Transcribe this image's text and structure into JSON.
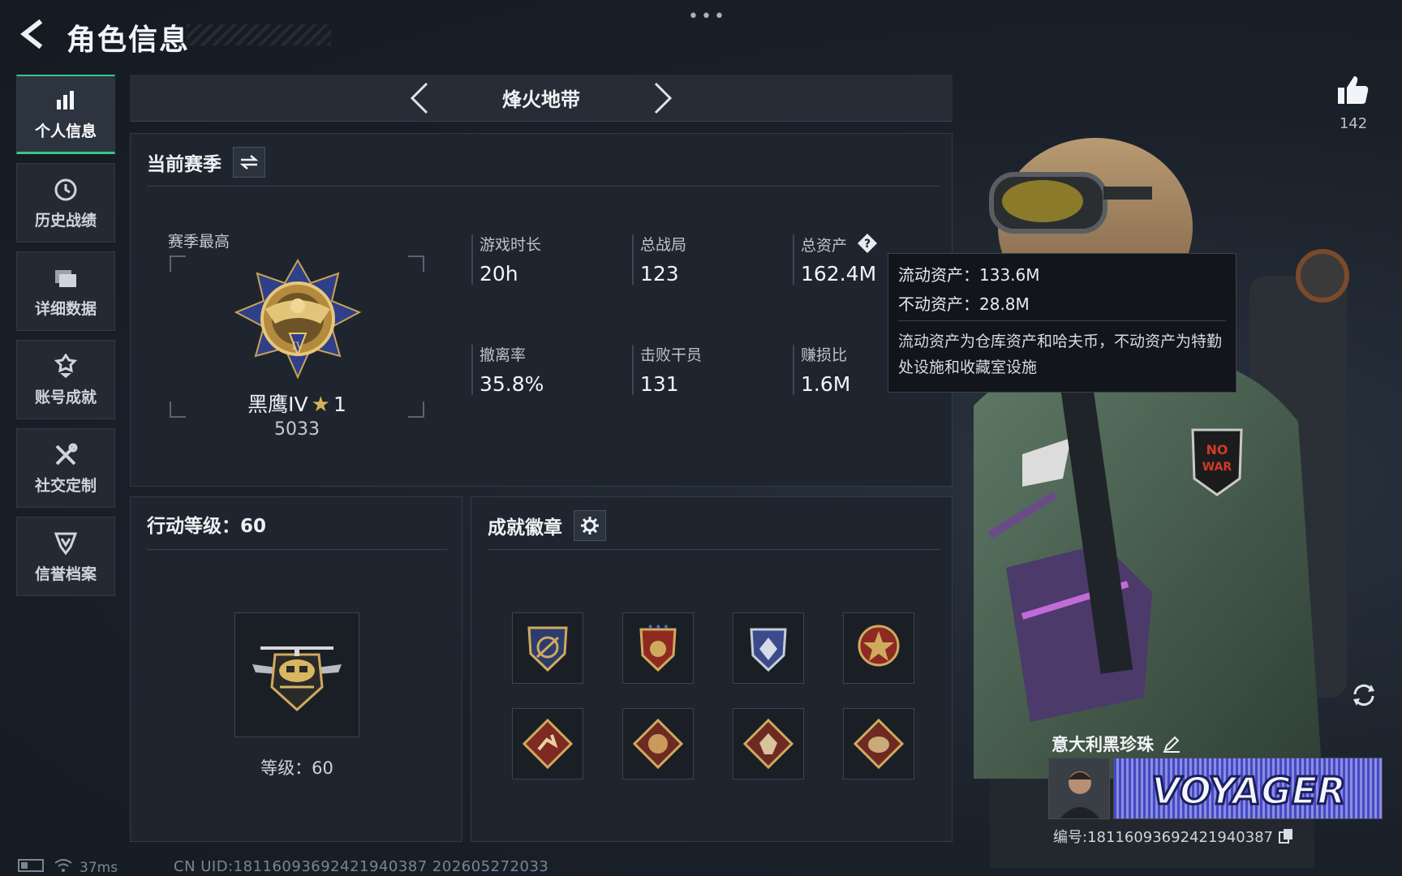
{
  "header": {
    "title": "角色信息",
    "menu_dots": "•••"
  },
  "nav": {
    "items": [
      {
        "label": "个人信息",
        "icon": "bar-chart-icon",
        "active": true
      },
      {
        "label": "历史战绩",
        "icon": "history-clock-icon",
        "active": false
      },
      {
        "label": "详细数据",
        "icon": "folder-icon",
        "active": false
      },
      {
        "label": "账号成就",
        "icon": "achievement-icon",
        "active": false
      },
      {
        "label": "社交定制",
        "icon": "tools-icon",
        "active": false
      },
      {
        "label": "信誉档案",
        "icon": "credit-shield-icon",
        "active": false
      }
    ]
  },
  "mode": {
    "title": "烽火地带"
  },
  "season": {
    "title": "当前赛季",
    "best_label": "赛季最高",
    "rank_name": "黑鹰IV",
    "rank_star_count": "1",
    "rank_points": "5033",
    "stats": {
      "play_time": {
        "label": "游戏时长",
        "value": "20h"
      },
      "total_matches": {
        "label": "总战局",
        "value": "123"
      },
      "total_assets": {
        "label": "总资产",
        "value": "162.4M"
      },
      "extract_rate": {
        "label": "撤离率",
        "value": "35.8%"
      },
      "kills": {
        "label": "击败干员",
        "value": "131"
      },
      "profit_ratio": {
        "label": "赚损比",
        "value": "1.6M"
      }
    }
  },
  "tooltip": {
    "liquid": "流动资产：133.6M",
    "fixed": "不动资产：28.8M",
    "desc": "流动资产为仓库资产和哈夫币，不动资产为特勤处设施和收藏室设施"
  },
  "level": {
    "title": "行动等级：60",
    "text": "等级：60"
  },
  "achievements": {
    "title": "成就徽章"
  },
  "like": {
    "count": "142"
  },
  "player": {
    "name": "意大利黑珍珠",
    "banner_text": "VOYAGER",
    "id_text": "编号:181160936924219403​87"
  },
  "status": {
    "ping": "37ms",
    "uid_line": "CN UID:18116093692421940387 202605272033"
  },
  "colors": {
    "accent_green": "#3cc489",
    "gold": "#d8b25a"
  }
}
